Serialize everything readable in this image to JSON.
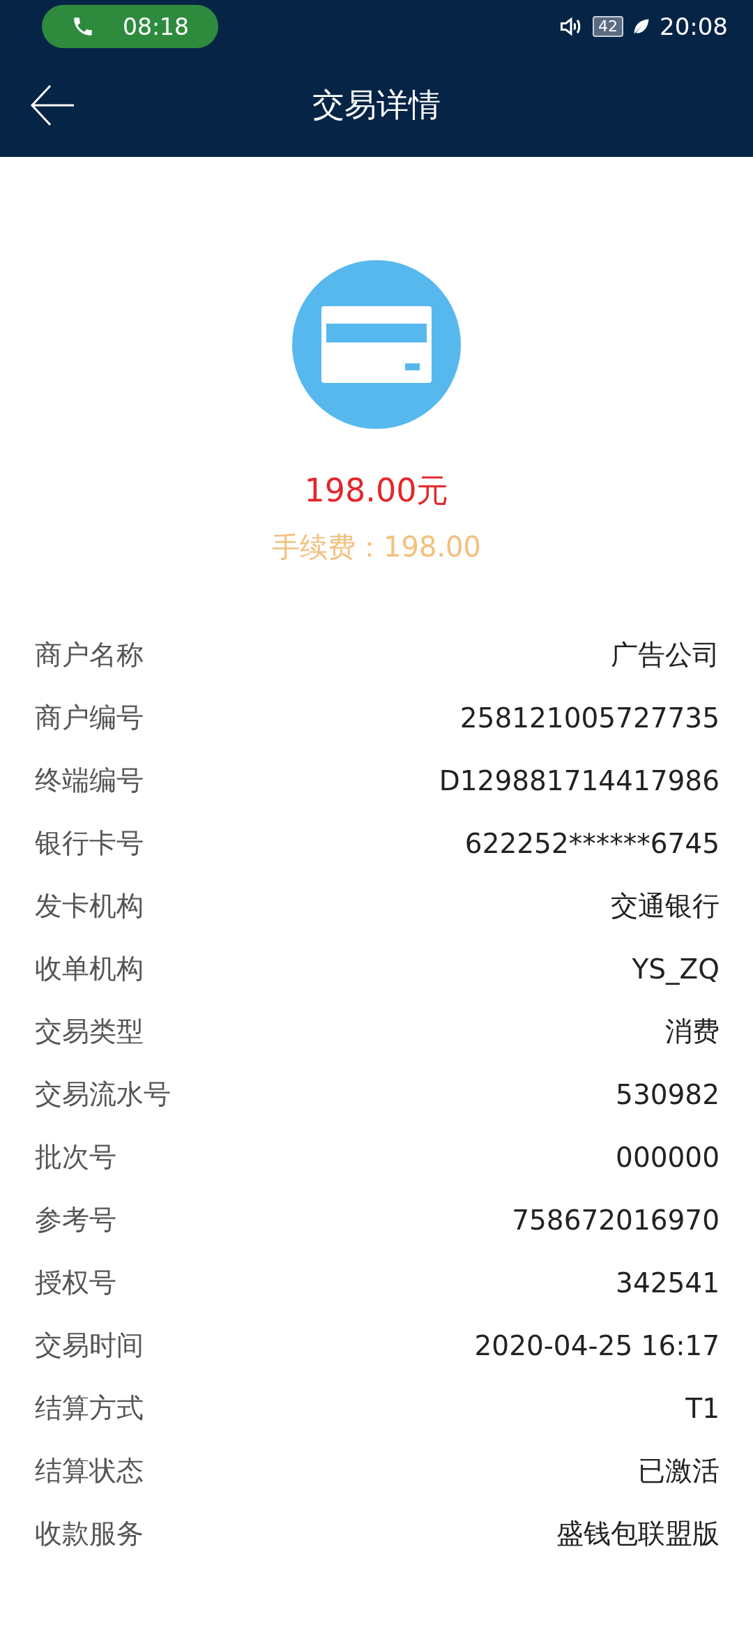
{
  "status_bar": {
    "call_time": "08:18",
    "battery": "42",
    "time": "20:08"
  },
  "header": {
    "title": "交易详情"
  },
  "summary": {
    "amount": "198.00元",
    "fee": "手续费：198.00"
  },
  "details": [
    {
      "label": "商户名称",
      "value": "广告公司"
    },
    {
      "label": "商户编号",
      "value": "258121005727735"
    },
    {
      "label": "终端编号",
      "value": "D129881714417986"
    },
    {
      "label": "银行卡号",
      "value": "622252******6745"
    },
    {
      "label": "发卡机构",
      "value": "交通银行"
    },
    {
      "label": "收单机构",
      "value": "YS_ZQ"
    },
    {
      "label": "交易类型",
      "value": "消费"
    },
    {
      "label": "交易流水号",
      "value": "530982"
    },
    {
      "label": "批次号",
      "value": "000000"
    },
    {
      "label": "参考号",
      "value": "758672016970"
    },
    {
      "label": "授权号",
      "value": "342541"
    },
    {
      "label": "交易时间",
      "value": "2020-04-25 16:17"
    },
    {
      "label": "结算方式",
      "value": "T1"
    },
    {
      "label": "结算状态",
      "value": "已激活"
    },
    {
      "label": "收款服务",
      "value": "盛钱包联盟版"
    }
  ]
}
